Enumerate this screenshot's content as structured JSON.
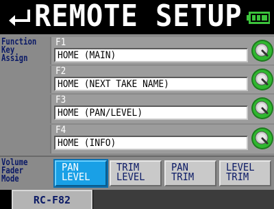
{
  "header": {
    "title": "REMOTE SETUP",
    "back_icon": "return-arrow-icon",
    "battery_icon": "battery-icon"
  },
  "function_key": {
    "section_label": "Function\nKey\nAssign",
    "rows": [
      {
        "label": "F1",
        "value": "HOME (MAIN)"
      },
      {
        "label": "F2",
        "value": "HOME (NEXT TAKE NAME)"
      },
      {
        "label": "F3",
        "value": "HOME (PAN/LEVEL)"
      },
      {
        "label": "F4",
        "value": "HOME (INFO)"
      }
    ]
  },
  "volume_fader": {
    "section_label": "Volume\nFader\nMode",
    "buttons": [
      {
        "label": "PAN\nLEVEL",
        "selected": true
      },
      {
        "label": "TRIM\nLEVEL",
        "selected": false
      },
      {
        "label": "PAN\nTRIM",
        "selected": false
      },
      {
        "label": "LEVEL\nTRIM",
        "selected": false
      }
    ]
  },
  "tabs": {
    "active": "RC-F82"
  },
  "colors": {
    "accent_selected": "#19a0e6",
    "label_text": "#0b1a66",
    "knob_green": "#2fb82f",
    "battery_green": "#3cc43c"
  }
}
